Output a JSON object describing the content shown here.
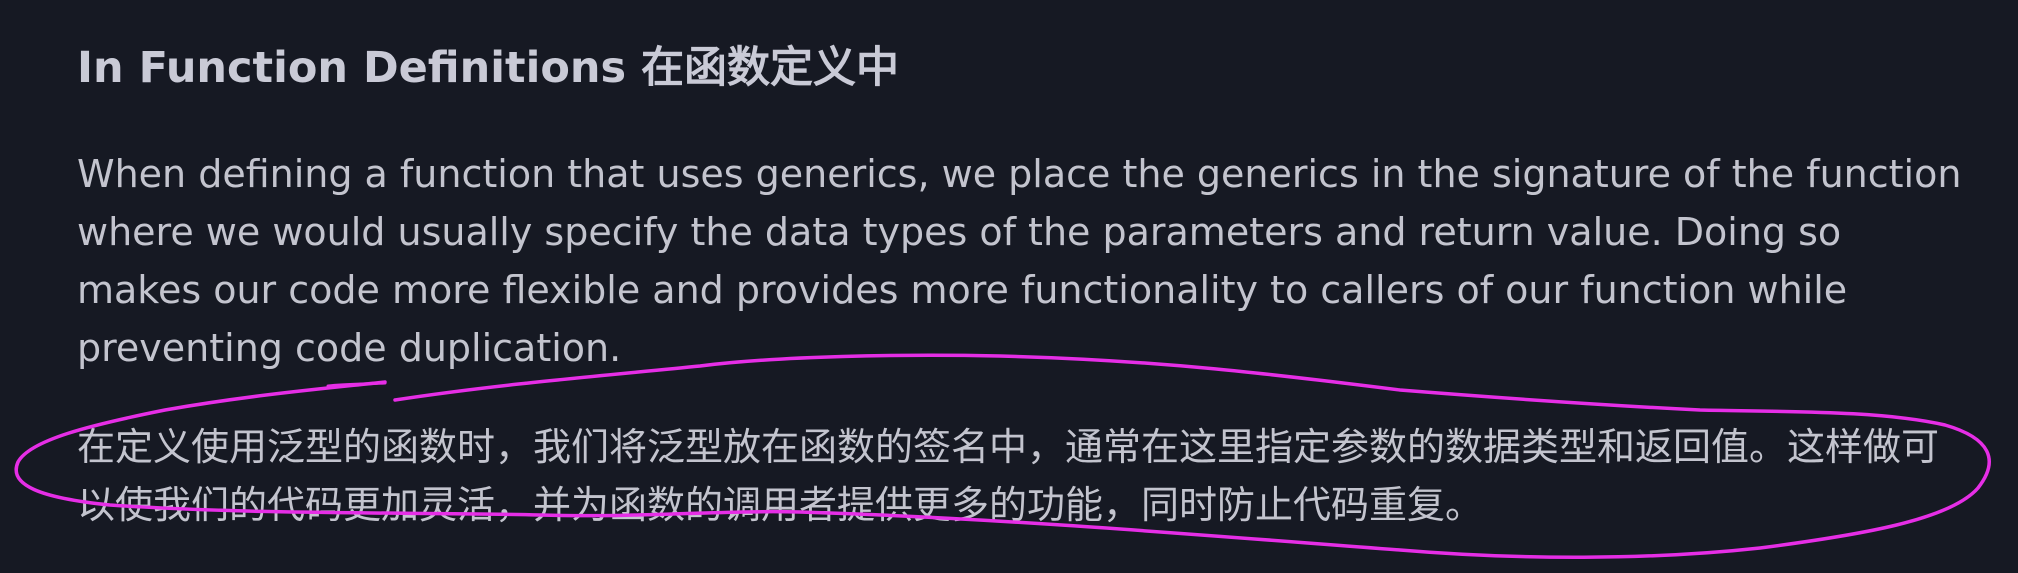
{
  "section": {
    "heading": "In Function Definitions 在函数定义中",
    "paragraph_en": "When defining a function that uses generics, we place the generics in the signature of the function where we would usually specify the data types of the parameters and return value. Doing so makes our code more flexible and provides more functionality to callers of our function while preventing code duplication.",
    "paragraph_zh": "在定义使用泛型的函数时，我们将泛型放在函数的签名中，通常在这里指定参数的数据类型和返回值。这样做可以使我们的代码更加灵活，并为函数的调用者提供更多的功能，同时防止代码重复。"
  },
  "colors": {
    "background": "#161923",
    "text": "#c3c4ce",
    "heading": "#c9cad6",
    "annotation": "#e62ee6"
  }
}
